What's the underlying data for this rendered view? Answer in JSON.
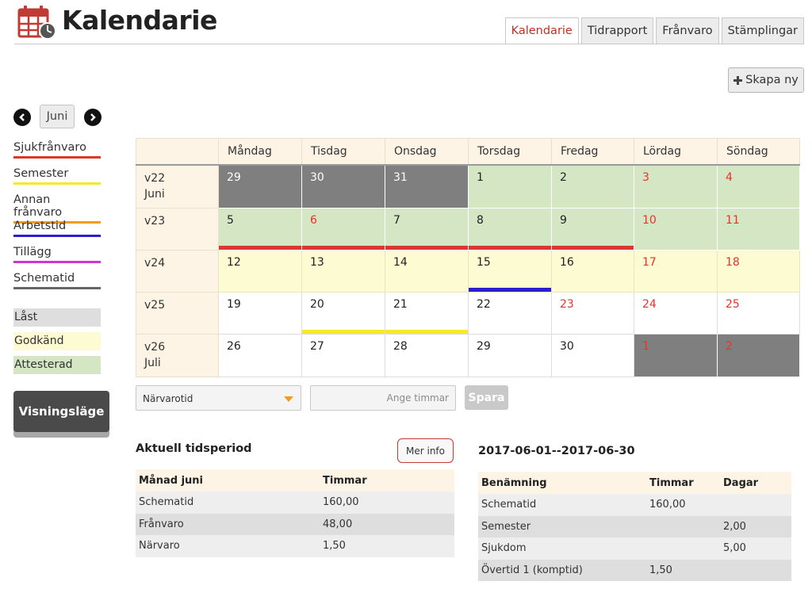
{
  "app": {
    "title": "Kalendarie"
  },
  "tabs": [
    {
      "label": "Kalendarie",
      "active": true
    },
    {
      "label": "Tidrapport",
      "active": false
    },
    {
      "label": "Frånvaro",
      "active": false
    },
    {
      "label": "Stämplingar",
      "active": false
    }
  ],
  "create_button": {
    "icon": "plus-icon",
    "label": "Skapa ny"
  },
  "month_nav": {
    "month": "Juni",
    "prev_icon": "chevron-left-icon",
    "next_icon": "chevron-right-icon"
  },
  "legend": [
    {
      "label": "Sjukfrånvaro",
      "color": "#d9392c"
    },
    {
      "label": "Semester",
      "color": "#f2ea2a"
    },
    {
      "label": "Annan frånvaro",
      "color": "#f39b1b"
    },
    {
      "label": "Arbetstid",
      "color": "#2a1fcc"
    },
    {
      "label": "Tillägg",
      "color": "#d433d4"
    },
    {
      "label": "Schematid",
      "color": "#666666"
    }
  ],
  "statuses": [
    {
      "label": "Låst",
      "color": "#dedede"
    },
    {
      "label": "Godkänd",
      "color": "#fdfbd2"
    },
    {
      "label": "Attesterad",
      "color": "#d4e6c4"
    }
  ],
  "view_button": {
    "label": "Visningsläge"
  },
  "calendar": {
    "days": [
      "Måndag",
      "Tisdag",
      "Onsdag",
      "Torsdag",
      "Fredag",
      "Lördag",
      "Söndag"
    ],
    "weeks": [
      {
        "week": "v22",
        "month": "Juni",
        "cells": [
          {
            "d": "29",
            "bg": "grey"
          },
          {
            "d": "30",
            "bg": "grey"
          },
          {
            "d": "31",
            "bg": "grey"
          },
          {
            "d": "1",
            "bg": "green"
          },
          {
            "d": "2",
            "bg": "green"
          },
          {
            "d": "3",
            "bg": "green",
            "red": true
          },
          {
            "d": "4",
            "bg": "green",
            "red": true
          }
        ]
      },
      {
        "week": "v23",
        "month": "",
        "cells": [
          {
            "d": "5",
            "bg": "green",
            "mark": "#d9392c"
          },
          {
            "d": "6",
            "bg": "green",
            "red": true,
            "mark": "#d9392c"
          },
          {
            "d": "7",
            "bg": "green",
            "mark": "#d9392c"
          },
          {
            "d": "8",
            "bg": "green",
            "mark": "#d9392c"
          },
          {
            "d": "9",
            "bg": "green",
            "mark": "#d9392c"
          },
          {
            "d": "10",
            "bg": "green",
            "red": true
          },
          {
            "d": "11",
            "bg": "green",
            "red": true
          }
        ]
      },
      {
        "week": "v24",
        "month": "",
        "cells": [
          {
            "d": "12",
            "bg": "yellow"
          },
          {
            "d": "13",
            "bg": "yellow"
          },
          {
            "d": "14",
            "bg": "yellow"
          },
          {
            "d": "15",
            "bg": "yellow",
            "mark": "#2a1fcc"
          },
          {
            "d": "16",
            "bg": "yellow"
          },
          {
            "d": "17",
            "bg": "yellow",
            "red": true
          },
          {
            "d": "18",
            "bg": "yellow",
            "red": true
          }
        ]
      },
      {
        "week": "v25",
        "month": "",
        "cells": [
          {
            "d": "19",
            "bg": "white"
          },
          {
            "d": "20",
            "bg": "white",
            "mark": "#f2ea2a"
          },
          {
            "d": "21",
            "bg": "white",
            "mark": "#f2ea2a"
          },
          {
            "d": "22",
            "bg": "white"
          },
          {
            "d": "23",
            "bg": "white",
            "red": true
          },
          {
            "d": "24",
            "bg": "white",
            "red": true
          },
          {
            "d": "25",
            "bg": "white",
            "red": true
          }
        ]
      },
      {
        "week": "v26",
        "month": "Juli",
        "cells": [
          {
            "d": "26",
            "bg": "white"
          },
          {
            "d": "27",
            "bg": "white"
          },
          {
            "d": "28",
            "bg": "white"
          },
          {
            "d": "29",
            "bg": "white"
          },
          {
            "d": "30",
            "bg": "white"
          },
          {
            "d": "1",
            "bg": "grey",
            "red": true
          },
          {
            "d": "2",
            "bg": "grey",
            "red": true
          }
        ]
      }
    ]
  },
  "controls": {
    "select_value": "Närvarotid",
    "hours_placeholder": "Ange timmar",
    "save_label": "Spara"
  },
  "period": {
    "title": "Aktuell tidsperiod",
    "info_label": "Mer info",
    "headers": [
      "Månad juni",
      "Timmar"
    ],
    "rows": [
      [
        "Schematid",
        "160,00"
      ],
      [
        "Frånvaro",
        "48,00"
      ],
      [
        "Närvaro",
        "1,50"
      ]
    ]
  },
  "range": {
    "title": "2017-06-01--2017-06-30",
    "headers": [
      "Benämning",
      "Timmar",
      "Dagar"
    ],
    "rows": [
      [
        "Schematid",
        "160,00",
        ""
      ],
      [
        "Semester",
        "",
        "2,00"
      ],
      [
        "Sjukdom",
        "",
        "5,00"
      ],
      [
        "Övertid 1 (komptid)",
        "1,50",
        ""
      ]
    ]
  }
}
